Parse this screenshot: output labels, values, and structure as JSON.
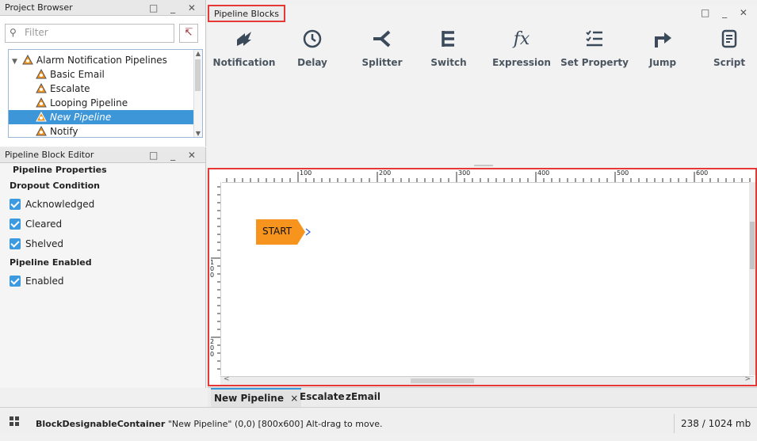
{
  "project_browser": {
    "title": "Project Browser",
    "controls": "□ _ ✕",
    "filter_placeholder": "Filter",
    "tree": [
      {
        "label": "Alarm Notification Pipelines"
      },
      {
        "label": "Basic Email"
      },
      {
        "label": "Escalate"
      },
      {
        "label": "Looping Pipeline"
      },
      {
        "label": "New Pipeline"
      },
      {
        "label": "Notify"
      }
    ]
  },
  "block_editor": {
    "title": "Pipeline Block Editor",
    "controls": "□ _ ✕",
    "section": "Pipeline Properties",
    "dropout_label": "Dropout Condition",
    "checks": [
      {
        "label": "Acknowledged",
        "checked": true
      },
      {
        "label": "Cleared",
        "checked": true
      },
      {
        "label": "Shelved",
        "checked": true
      }
    ],
    "enabled_label": "Pipeline Enabled",
    "enabled_check": {
      "label": "Enabled",
      "checked": true
    }
  },
  "pipeline_blocks": {
    "title": "Pipeline Blocks",
    "controls": "□ _ ✕",
    "blocks": [
      {
        "label": "Notification",
        "icon": "notification-icon"
      },
      {
        "label": "Delay",
        "icon": "clock-icon"
      },
      {
        "label": "Splitter",
        "icon": "splitter-icon"
      },
      {
        "label": "Switch",
        "icon": "switch-icon"
      },
      {
        "label": "Expression",
        "icon": "fx-icon"
      },
      {
        "label": "Set Property",
        "icon": "checklist-icon"
      },
      {
        "label": "Jump",
        "icon": "jump-arrow-icon"
      },
      {
        "label": "Script",
        "icon": "script-icon"
      }
    ]
  },
  "canvas": {
    "ruler_top": [
      "100",
      "200",
      "300",
      "400",
      "500",
      "600"
    ],
    "ruler_left": [
      "100",
      "200"
    ],
    "start_label": "START",
    "start_color": "#f7941d"
  },
  "doc_tabs": [
    {
      "label": "New Pipeline",
      "active": true,
      "close": "×"
    },
    {
      "label": "Escalate",
      "active": false
    },
    {
      "label": "zEmail",
      "active": false
    }
  ],
  "status": {
    "component": "BlockDesignableContainer",
    "message": "\"New Pipeline\" (0,0) [800x600] Alt-drag to move.",
    "memory": "238 / 1024 mb"
  },
  "colors": {
    "accent": "#3c96d8",
    "highlight": "#e53935"
  }
}
